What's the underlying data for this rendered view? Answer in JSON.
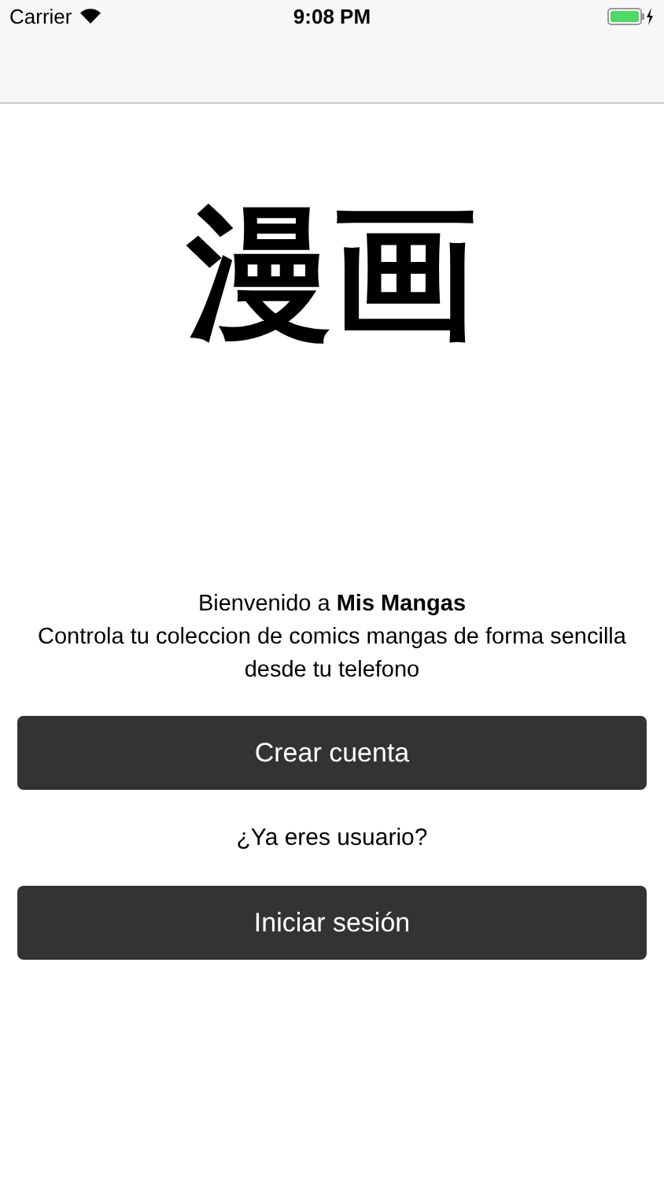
{
  "status_bar": {
    "carrier": "Carrier",
    "time": "9:08 PM"
  },
  "logo": "漫画",
  "welcome": "Bienvenido a **Mis Mangas**\nControla tu coleccion de comics mangas de forma sencilla desde tu telefono",
  "buttons": [
    {
      "kind": "button",
      "label": "Crear cuenta"
    },
    {
      "kind": "prompt",
      "label": "¿Ya eres usuario?"
    },
    {
      "kind": "button",
      "label": "Iniciar sesión"
    }
  ]
}
